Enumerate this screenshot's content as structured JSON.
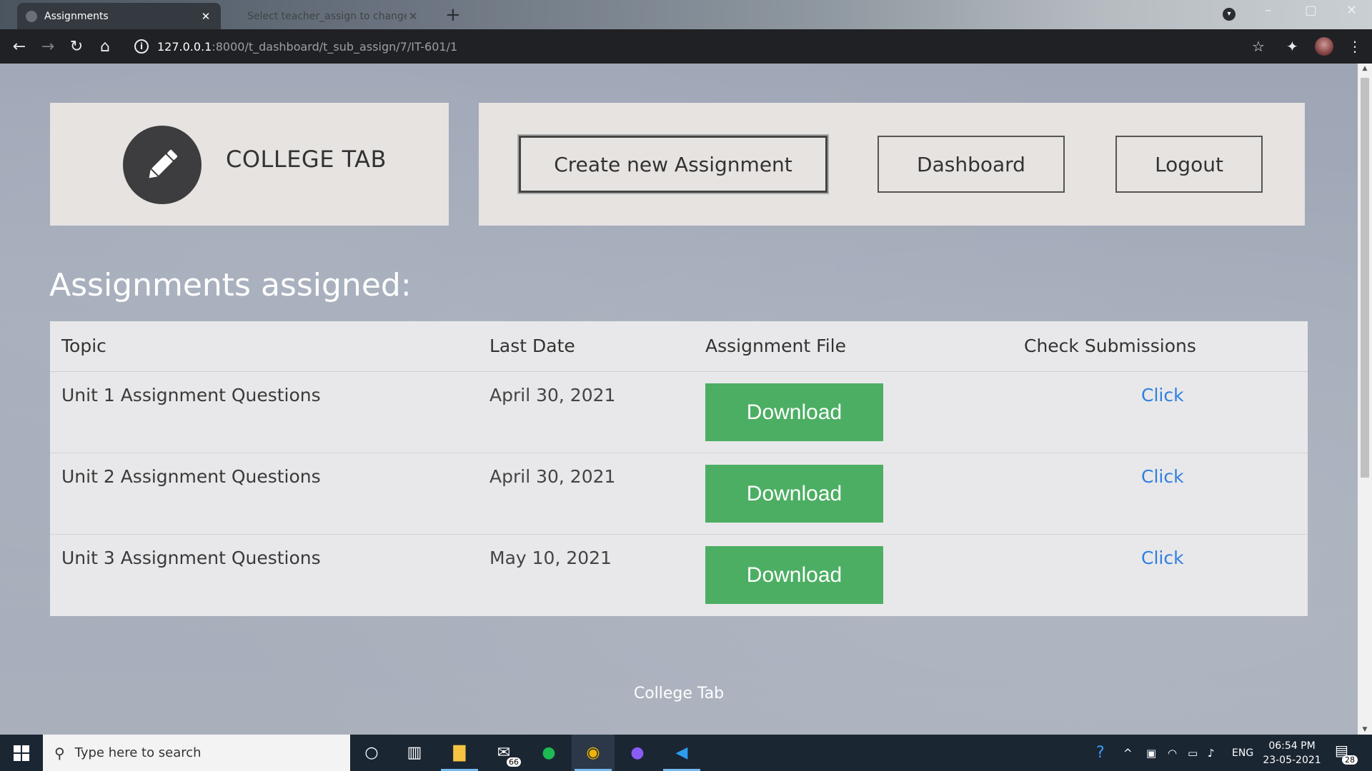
{
  "browser": {
    "tabs": [
      {
        "title": "Assignments",
        "active": true
      },
      {
        "title": "Select teacher_assign to change",
        "active": false
      }
    ],
    "url_host": "127.0.0.1",
    "url_path": ":8000/t_dashboard/t_sub_assign/7/IT-601/1"
  },
  "header": {
    "brand": "COLLEGE TAB",
    "nav": {
      "create": "Create new Assignment",
      "dashboard": "Dashboard",
      "logout": "Logout"
    }
  },
  "main": {
    "title": "Assignments assigned:",
    "columns": [
      "Topic",
      "Last Date",
      "Assignment File",
      "Check Submissions"
    ],
    "rows": [
      {
        "topic": "Unit 1 Assignment Questions",
        "last_date": "April 30, 2021",
        "file_button": "Download",
        "submissions_link": "Click"
      },
      {
        "topic": "Unit 2 Assignment Questions",
        "last_date": "April 30, 2021",
        "file_button": "Download",
        "submissions_link": "Click"
      },
      {
        "topic": "Unit 3 Assignment Questions",
        "last_date": "May 10, 2021",
        "file_button": "Download",
        "submissions_link": "Click"
      }
    ]
  },
  "footer": {
    "text": "College Tab"
  },
  "taskbar": {
    "search_placeholder": "Type here to search",
    "mail_badge": "66",
    "language": "ENG",
    "time": "06:54 PM",
    "date": "23-05-2021",
    "notification_count": "28"
  },
  "colors": {
    "download_green": "#4cae63",
    "link_blue": "#2f7fe0"
  }
}
